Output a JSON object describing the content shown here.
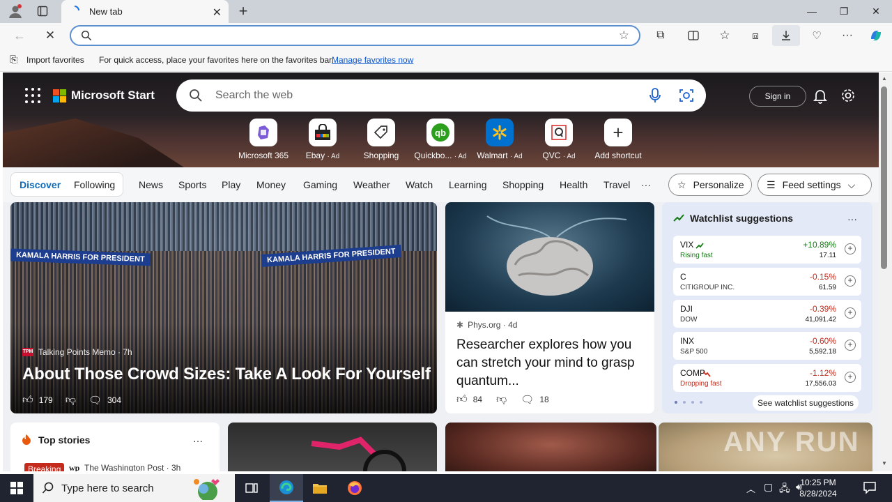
{
  "browser": {
    "tab_title": "New tab",
    "address_value": "",
    "favorites_bar": {
      "import_label": "Import favorites",
      "hint": "For quick access, place your favorites here on the favorites bar.",
      "manage_link": "Manage favorites now"
    }
  },
  "header": {
    "brand": "Microsoft Start",
    "search_placeholder": "Search the web",
    "sign_in": "Sign in"
  },
  "shortcuts": [
    {
      "label": "Microsoft 365",
      "ad": ""
    },
    {
      "label": "Ebay",
      "ad": "· Ad"
    },
    {
      "label": "Shopping",
      "ad": ""
    },
    {
      "label": "Quickbo...",
      "ad": "· Ad"
    },
    {
      "label": "Walmart",
      "ad": "· Ad"
    },
    {
      "label": "QVC",
      "ad": "· Ad"
    },
    {
      "label": "Add shortcut",
      "ad": ""
    }
  ],
  "nav": {
    "discover": "Discover",
    "following": "Following",
    "links": [
      "News",
      "Sports",
      "Play",
      "Money",
      "Gaming",
      "Weather",
      "Watch",
      "Learning",
      "Shopping",
      "Health",
      "Travel"
    ],
    "more": "···",
    "personalize": "Personalize",
    "feed_settings": "Feed settings"
  },
  "main_story": {
    "banner_left": "KAMALA HARRIS FOR PRESIDENT",
    "banner_right": "KAMALA HARRIS FOR PRESIDENT",
    "source": "Talking Points Memo · 7h",
    "headline": "About Those Crowd Sizes: Take A Look For Yourself",
    "likes": "179",
    "comments": "304"
  },
  "article": {
    "source": "Phys.org · 4d",
    "headline": "Researcher explores how you can stretch your mind to grasp quantum...",
    "likes": "84",
    "comments": "18"
  },
  "watchlist": {
    "title": "Watchlist suggestions",
    "more": "···",
    "stocks": [
      {
        "symbol": "VIX",
        "sub": "Rising fast",
        "change": "+10.89%",
        "price": "17.11",
        "trend": "up"
      },
      {
        "symbol": "C",
        "sub": "CITIGROUP INC.",
        "change": "-0.15%",
        "price": "61.59",
        "trend": "down"
      },
      {
        "symbol": "DJI",
        "sub": "DOW",
        "change": "-0.39%",
        "price": "41,091.42",
        "trend": "down"
      },
      {
        "symbol": "INX",
        "sub": "S&P 500",
        "change": "-0.60%",
        "price": "5,592.18",
        "trend": "down"
      },
      {
        "symbol": "COMP",
        "sub": "Dropping fast",
        "change": "-1.12%",
        "price": "17,556.03",
        "trend": "down"
      }
    ],
    "see_more": "See watchlist suggestions",
    "colors": {
      "up": "#107c10",
      "down": "#c42b1c"
    }
  },
  "top_stories": {
    "title": "Top stories",
    "more": "···",
    "badge": "Breaking",
    "source": "The Washington Post · 3h"
  },
  "watermark": "ANY RUN",
  "taskbar": {
    "search_placeholder": "Type here to search",
    "time": "10:25 PM",
    "date": "8/28/2024"
  }
}
